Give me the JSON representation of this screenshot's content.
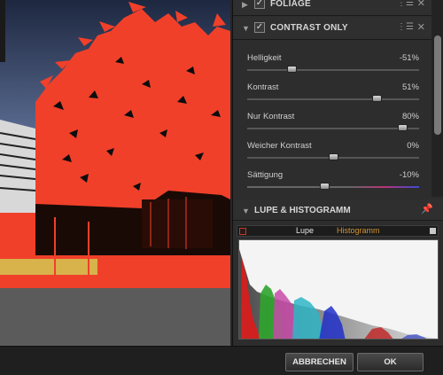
{
  "panel": {
    "foliage": {
      "title": "FOLIAGE"
    },
    "contrast_only": {
      "title": "CONTRAST ONLY",
      "sliders": [
        {
          "label": "Helligkeit",
          "value": "-51%",
          "pos": 0.26
        },
        {
          "label": "Kontrast",
          "value": "51%",
          "pos": 0.755
        },
        {
          "label": "Nur Kontrast",
          "value": "80%",
          "pos": 0.9
        },
        {
          "label": "Weicher Kontrast",
          "value": "0%",
          "pos": 0.5
        },
        {
          "label": "Sättigung",
          "value": "-10%",
          "pos": 0.45
        }
      ]
    },
    "loupe_histogram": {
      "title": "LUPE & HISTOGRAMM",
      "tab_loupe": "Lupe",
      "tab_histogram": "Histogramm"
    }
  },
  "footer": {
    "cancel_label": "ABBRECHEN",
    "ok_label": "OK"
  },
  "icons": {
    "expand": "triangle-right-icon",
    "collapse": "triangle-down-icon",
    "checkbox": "checkbox-checked-icon",
    "menu": "list-menu-icon",
    "close": "close-icon",
    "pin": "pin-icon"
  },
  "colors": {
    "accent_tab": "#d49432",
    "preview_red": "#f0402a"
  }
}
